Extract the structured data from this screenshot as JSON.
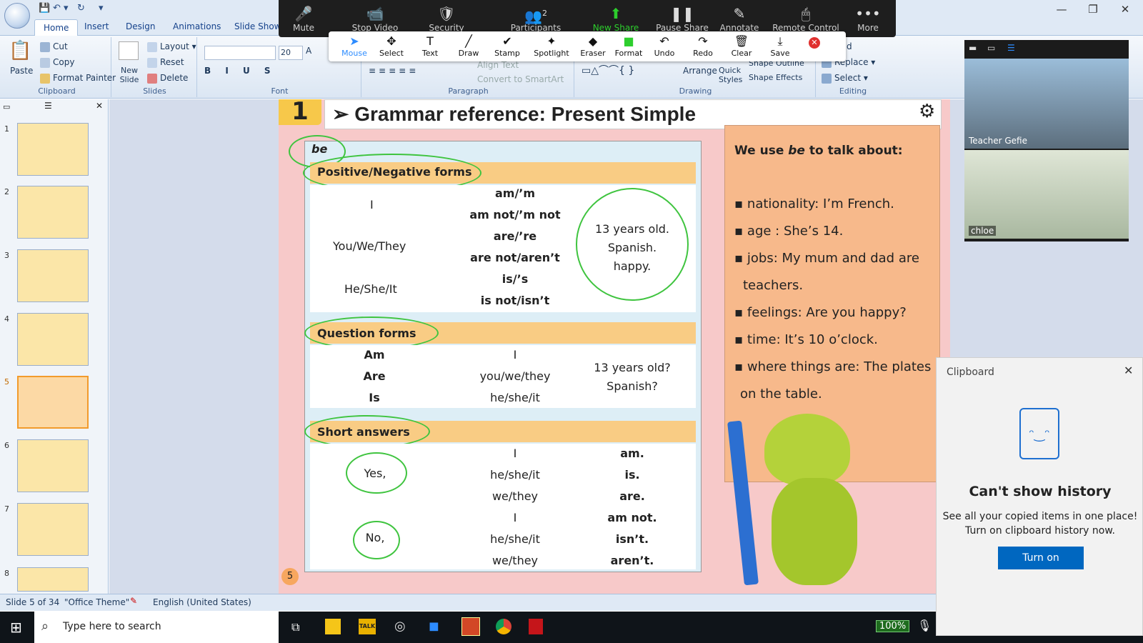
{
  "ribbon": {
    "tabs": [
      "Home",
      "Insert",
      "Design",
      "Animations",
      "Slide Show"
    ],
    "clipboard": {
      "paste": "Paste",
      "cut": "Cut",
      "copy": "Copy",
      "format_painter": "Format Painter",
      "label": "Clipboard"
    },
    "slides": {
      "new_slide": "New Slide",
      "layout": "Layout",
      "reset": "Reset",
      "delete": "Delete",
      "label": "Slides"
    },
    "font": {
      "size": "20",
      "label": "Font"
    },
    "paragraph": {
      "align_text": "Align Text",
      "convert": "Convert to SmartArt",
      "label": "Paragraph"
    },
    "drawing": {
      "arrange": "Arrange",
      "quick_styles": "Quick Styles",
      "shape_outline": "Shape Outline",
      "shape_effects": "Shape Effects",
      "label": "Drawing"
    },
    "editing": {
      "find": "Find",
      "replace": "Replace",
      "select": "Select",
      "label": "Editing"
    }
  },
  "zoom": {
    "items": [
      "Mute",
      "Stop Video",
      "Security",
      "Participants",
      "New Share",
      "Pause Share",
      "Annotate",
      "Remote Control",
      "More"
    ],
    "participants_count": "2",
    "annotate_tools": [
      "Mouse",
      "Select",
      "Text",
      "Draw",
      "Stamp",
      "Spotlight",
      "Eraser",
      "Format",
      "Undo",
      "Redo",
      "Clear",
      "Save"
    ]
  },
  "video": {
    "tiles": [
      {
        "name": "Teacher Gefie"
      },
      {
        "name": "chloe"
      }
    ]
  },
  "slide": {
    "number_badge": "1",
    "title": "➢ Grammar reference: Present Simple",
    "be": "be",
    "positive_header": "Positive/Negative forms",
    "rows": [
      {
        "subject": "I",
        "forms": [
          "am/’m",
          "am not/’m not"
        ]
      },
      {
        "subject": "You/We/They",
        "forms": [
          "are/’re",
          "are not/aren’t"
        ]
      },
      {
        "subject": "He/She/It",
        "forms": [
          "is/’s",
          "is not/isn’t"
        ]
      }
    ],
    "examples": [
      "13 years old.",
      "Spanish.",
      "happy."
    ],
    "question_header": "Question forms",
    "questions": [
      {
        "verb": "Am",
        "subject": "I"
      },
      {
        "verb": "Are",
        "subject": "you/we/they"
      },
      {
        "verb": "Is",
        "subject": "he/she/it"
      }
    ],
    "question_examples": [
      "13 years old?",
      "Spanish?"
    ],
    "short_header": "Short answers",
    "yes": "Yes,",
    "no": "No,",
    "yes_rows": [
      {
        "s": "I",
        "v": "am."
      },
      {
        "s": "he/she/it",
        "v": "is."
      },
      {
        "s": "we/they",
        "v": "are."
      }
    ],
    "no_rows": [
      {
        "s": "I",
        "v": "am not."
      },
      {
        "s": "he/she/it",
        "v": "isn’t."
      },
      {
        "s": "we/they",
        "v": "aren’t."
      }
    ],
    "page_number": "5",
    "right_heading_a": "We use ",
    "right_heading_b": "be",
    "right_heading_c": " to talk about:",
    "bullets": [
      "nationality: I’m French.",
      "age : She’s 14.",
      "jobs: My mum and dad are",
      "teachers.",
      "feelings: Are you happy?",
      "time: It’s 10 o’clock.",
      "where things are: The plates ar",
      "on the table."
    ]
  },
  "thumbs": [
    "1",
    "2",
    "3",
    "4",
    "5",
    "6",
    "7",
    "8"
  ],
  "status": {
    "slide": "Slide 5 of 34",
    "theme": "\"Office Theme\"",
    "lang": "English (United States)"
  },
  "taskbar": {
    "search": "Type here to search",
    "zoom": "100%"
  },
  "clipboard_panel": {
    "title": "Clipboard",
    "heading": "Can't show history",
    "line1": "See all your copied items in one place!",
    "line2": "Turn on clipboard history now.",
    "button": "Turn on"
  }
}
